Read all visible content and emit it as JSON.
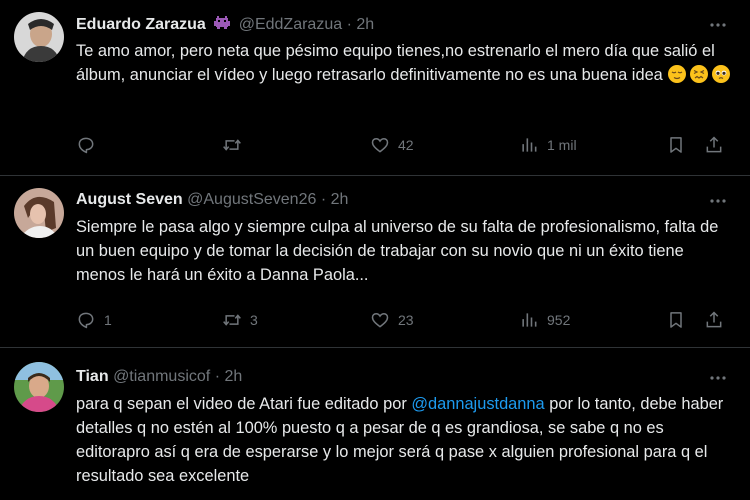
{
  "tweets": [
    {
      "name": "Eduardo Zarazua",
      "handle": "@EddZarazua",
      "sep": "·",
      "time": "2h",
      "text": "Te amo amor, pero neta que pésimo equipo tienes,no estrenarlo el mero día que salió el álbum, anunciar el vídeo y luego retrasarlo definitivamente no es una buena idea",
      "emojis": [
        "relieved-face",
        "confounded-face",
        "pleading-face"
      ],
      "badge": "alien-monster-emoji",
      "replies": "",
      "retweets": "",
      "likes": "42",
      "views": "1 mil",
      "avatar_color": "#cfcfcf"
    },
    {
      "name": "August Seven",
      "handle": "@AugustSeven26",
      "sep": "·",
      "time": "2h",
      "text": "Siempre le pasa algo y siempre culpa al universo de su falta de profesionalismo, falta de un buen equipo y de tomar la decisión de trabajar con su novio que ni un éxito tiene menos le hará un éxito a Danna Paola...",
      "replies": "1",
      "retweets": "3",
      "likes": "23",
      "views": "952",
      "avatar_color": "#b89a8a"
    },
    {
      "name": "Tian",
      "handle": "@tianmusicof",
      "sep": "·",
      "time": "2h",
      "text_before": "para q sepan el video de Atari fue editado por ",
      "mention": "@dannajustdanna",
      "text_after": " por lo tanto, debe haber detalles q no estén al 100% puesto q a pesar de q es grandiosa, se sabe q no es editorapro así q era de esperarse y lo mejor será q pase x alguien profesional para q el resultado sea excelente",
      "avatar_color": "#4a7a3a"
    }
  ],
  "icons": {
    "reply": "reply-icon",
    "retweet": "retweet-icon",
    "like": "heart-icon",
    "views": "views-chart-icon",
    "bookmark": "bookmark-icon",
    "share": "share-icon",
    "more": "more-icon"
  },
  "colors": {
    "background": "#000000",
    "text": "#e7e9ea",
    "secondary": "#71767b",
    "link": "#1d9bf0",
    "divider": "#2f3336"
  }
}
